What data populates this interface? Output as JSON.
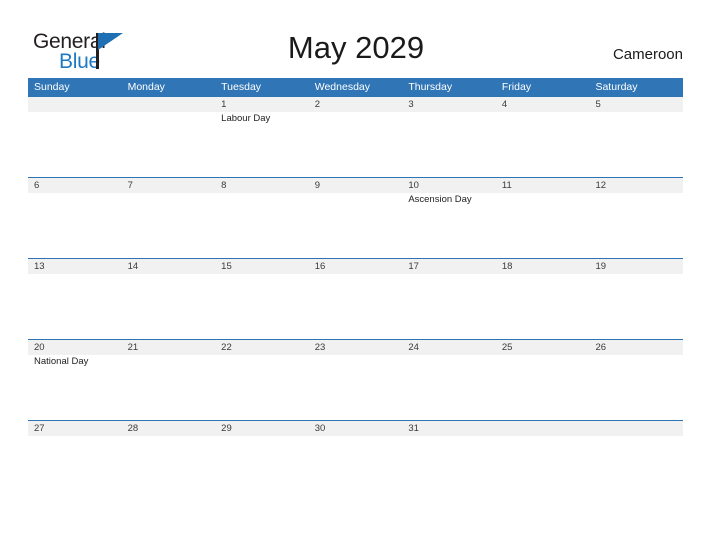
{
  "brand": {
    "name_part1": "General",
    "name_part2": "Blue",
    "triangle_icon": "brand-triangle-icon",
    "accent_color": "#1f6fb4",
    "text_color": "#231f20"
  },
  "header": {
    "title": "May 2029",
    "country": "Cameroon"
  },
  "theme": {
    "header_blue": "#3075b5",
    "row_divider_blue": "#2e74b5",
    "band_gray": "#f1f1f1",
    "page_background": "#ffffff"
  },
  "calendar": {
    "month": "May",
    "year": "2029",
    "weekday_headers": [
      "Sunday",
      "Monday",
      "Tuesday",
      "Wednesday",
      "Thursday",
      "Friday",
      "Saturday"
    ],
    "weeks": [
      {
        "days": [
          {
            "num": "",
            "event": ""
          },
          {
            "num": "",
            "event": ""
          },
          {
            "num": "1",
            "event": "Labour Day"
          },
          {
            "num": "2",
            "event": ""
          },
          {
            "num": "3",
            "event": ""
          },
          {
            "num": "4",
            "event": ""
          },
          {
            "num": "5",
            "event": ""
          }
        ]
      },
      {
        "days": [
          {
            "num": "6",
            "event": ""
          },
          {
            "num": "7",
            "event": ""
          },
          {
            "num": "8",
            "event": ""
          },
          {
            "num": "9",
            "event": ""
          },
          {
            "num": "10",
            "event": "Ascension Day"
          },
          {
            "num": "11",
            "event": ""
          },
          {
            "num": "12",
            "event": ""
          }
        ]
      },
      {
        "days": [
          {
            "num": "13",
            "event": ""
          },
          {
            "num": "14",
            "event": ""
          },
          {
            "num": "15",
            "event": ""
          },
          {
            "num": "16",
            "event": ""
          },
          {
            "num": "17",
            "event": ""
          },
          {
            "num": "18",
            "event": ""
          },
          {
            "num": "19",
            "event": ""
          }
        ]
      },
      {
        "days": [
          {
            "num": "20",
            "event": "National Day"
          },
          {
            "num": "21",
            "event": ""
          },
          {
            "num": "22",
            "event": ""
          },
          {
            "num": "23",
            "event": ""
          },
          {
            "num": "24",
            "event": ""
          },
          {
            "num": "25",
            "event": ""
          },
          {
            "num": "26",
            "event": ""
          }
        ]
      },
      {
        "days": [
          {
            "num": "27",
            "event": ""
          },
          {
            "num": "28",
            "event": ""
          },
          {
            "num": "29",
            "event": ""
          },
          {
            "num": "30",
            "event": ""
          },
          {
            "num": "31",
            "event": ""
          },
          {
            "num": "",
            "event": ""
          },
          {
            "num": "",
            "event": ""
          }
        ]
      }
    ]
  }
}
